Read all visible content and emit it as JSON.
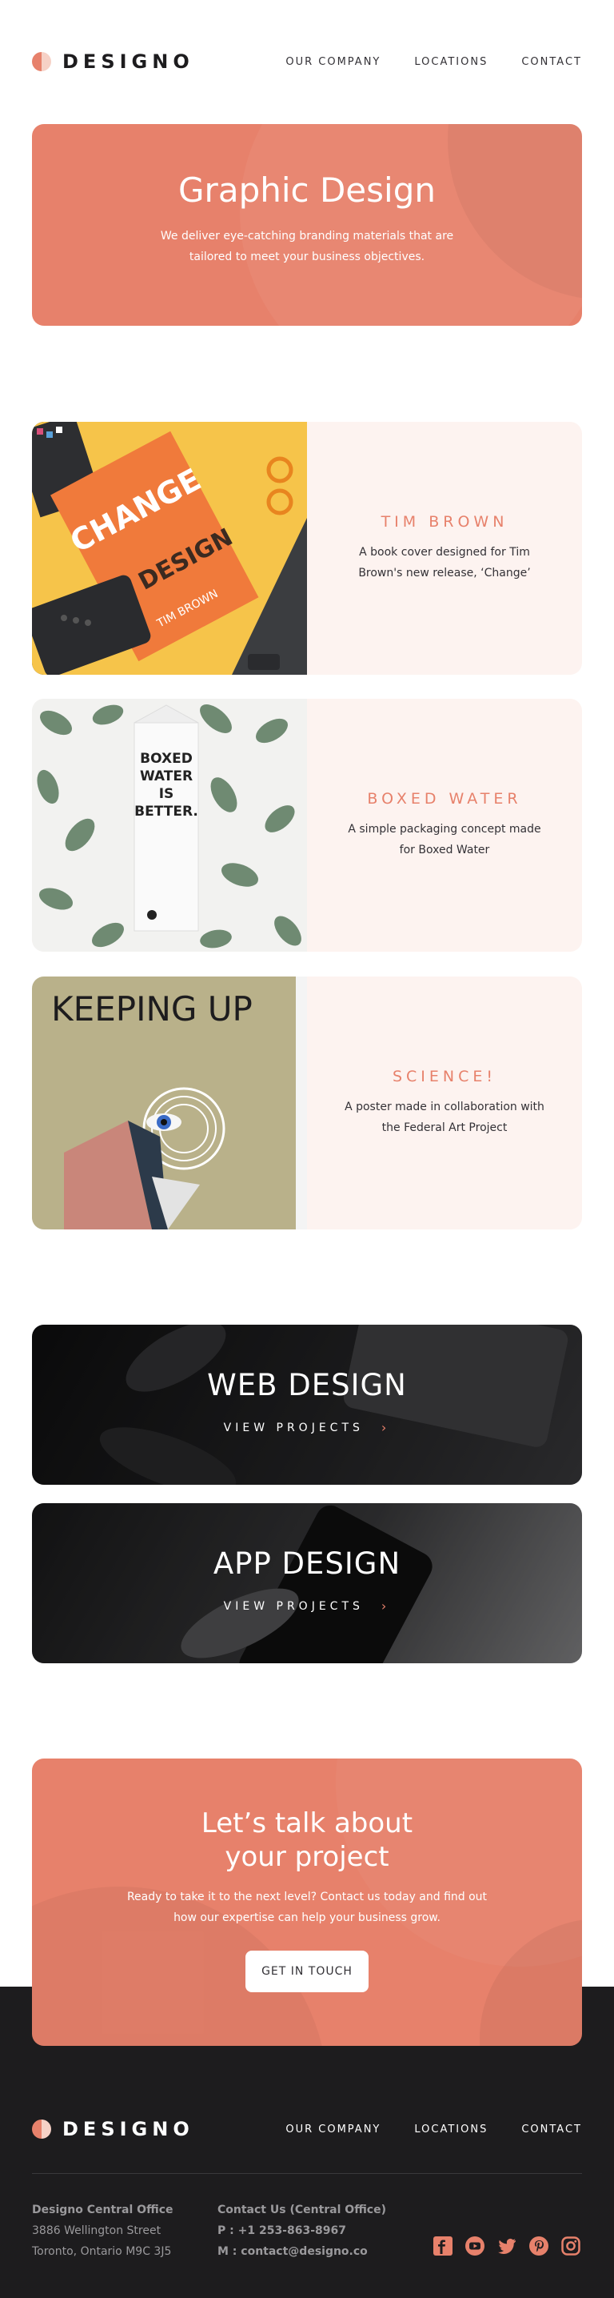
{
  "brand": {
    "name": "DESIGNO"
  },
  "nav": {
    "items": [
      "OUR COMPANY",
      "LOCATIONS",
      "CONTACT"
    ]
  },
  "hero": {
    "title": "Graphic Design",
    "text": "We deliver eye-catching branding materials that are tailored to meet your business objectives."
  },
  "projects": [
    {
      "title": "TIM BROWN",
      "text": "A book cover designed for Tim Brown's new release, ‘Change’",
      "image_text": [
        "CHANGE",
        "BY DESIGN",
        "TIM BROWN"
      ]
    },
    {
      "title": "BOXED WATER",
      "text": "A simple packaging concept made for Boxed Water",
      "image_text": [
        "BOXED",
        "WATER",
        "IS",
        "BETTER."
      ]
    },
    {
      "title": "SCIENCE!",
      "text": "A poster made in collaboration with the Federal Art Project",
      "image_text": [
        "KEEPING UP"
      ]
    }
  ],
  "cards": [
    {
      "title": "WEB DESIGN",
      "link": "VIEW PROJECTS"
    },
    {
      "title": "APP DESIGN",
      "link": "VIEW PROJECTS"
    }
  ],
  "cta": {
    "title_line1": "Let’s talk about",
    "title_line2": "your project",
    "text": "Ready to take it to the next level? Contact us today and find out how our expertise can help your business grow.",
    "button": "GET IN TOUCH"
  },
  "footer": {
    "office_title": "Designo Central Office",
    "office_line1": "3886 Wellington Street",
    "office_line2": "Toronto, Ontario M9C 3J5",
    "contact_title": "Contact Us (Central Office)",
    "phone_label": "P :",
    "phone": "+1 253-863-8967",
    "email_label": "M :",
    "email": "contact@designo.co",
    "social": [
      "facebook-icon",
      "youtube-icon",
      "twitter-icon",
      "pinterest-icon",
      "instagram-icon"
    ]
  },
  "colors": {
    "accent": "#e7816b",
    "peach": "#fdf3f0",
    "dark": "#1d1c1e",
    "text": "#333136"
  }
}
